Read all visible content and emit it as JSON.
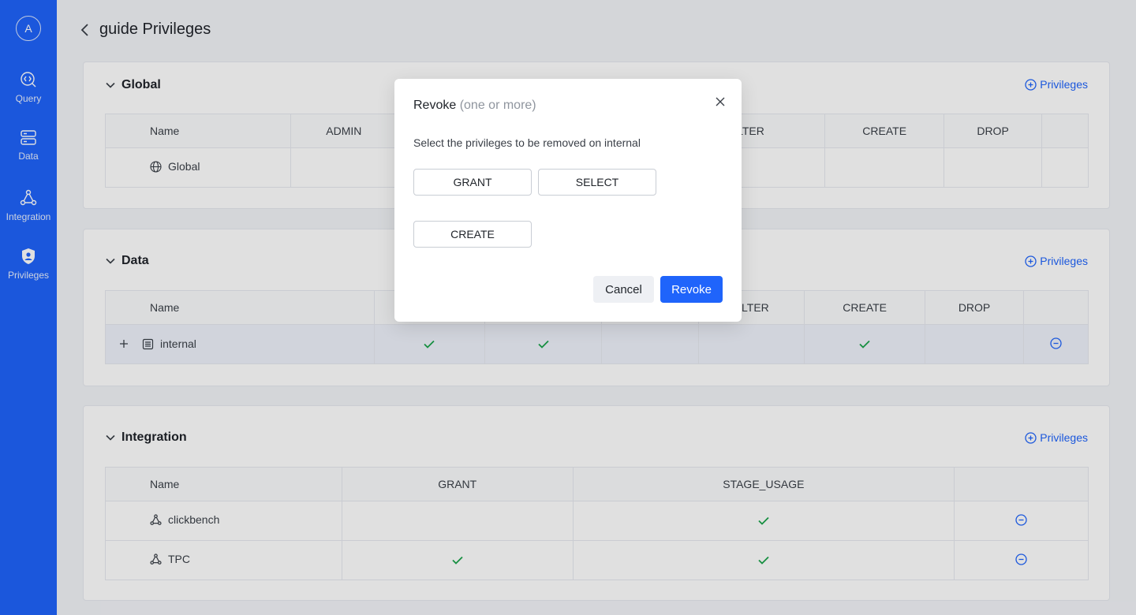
{
  "sidebar": {
    "avatar_initial": "A",
    "items": [
      {
        "label": "Query",
        "icon": "query-icon"
      },
      {
        "label": "Data",
        "icon": "data-icon"
      },
      {
        "label": "Integration",
        "icon": "integration-icon"
      },
      {
        "label": "Privileges",
        "icon": "privileges-icon"
      }
    ]
  },
  "header": {
    "title": "guide Privileges"
  },
  "global_card": {
    "title": "Global",
    "add_label": "Privileges",
    "columns": [
      "Name",
      "ADMIN",
      "",
      "",
      "ALTER",
      "CREATE",
      "DROP",
      ""
    ],
    "rows": [
      {
        "name": "Global",
        "icon": "globe-icon"
      }
    ]
  },
  "data_card": {
    "title": "Data",
    "add_label": "Privileges",
    "columns": [
      "Name",
      "",
      "",
      "",
      "ALTER",
      "CREATE",
      "DROP",
      ""
    ],
    "rows": [
      {
        "name": "internal",
        "icon": "database-icon",
        "checks": [
          true,
          true,
          false,
          false,
          true,
          false
        ]
      }
    ]
  },
  "integration_card": {
    "title": "Integration",
    "add_label": "Privileges",
    "columns": [
      "Name",
      "GRANT",
      "STAGE_USAGE",
      ""
    ],
    "rows": [
      {
        "name": "clickbench",
        "icon": "integration-icon",
        "checks": [
          false,
          true
        ]
      },
      {
        "name": "TPC",
        "icon": "integration-icon",
        "checks": [
          true,
          true
        ]
      }
    ]
  },
  "modal": {
    "title": "Revoke",
    "title_hint": "(one or more)",
    "description": "Select the privileges to be removed on internal",
    "options": [
      "GRANT",
      "SELECT",
      "CREATE"
    ],
    "cancel_label": "Cancel",
    "revoke_label": "Revoke"
  },
  "colors": {
    "brand": "#1f64fb",
    "check": "#1aa34a",
    "overlay": "rgba(0,0,0,0.12)"
  }
}
